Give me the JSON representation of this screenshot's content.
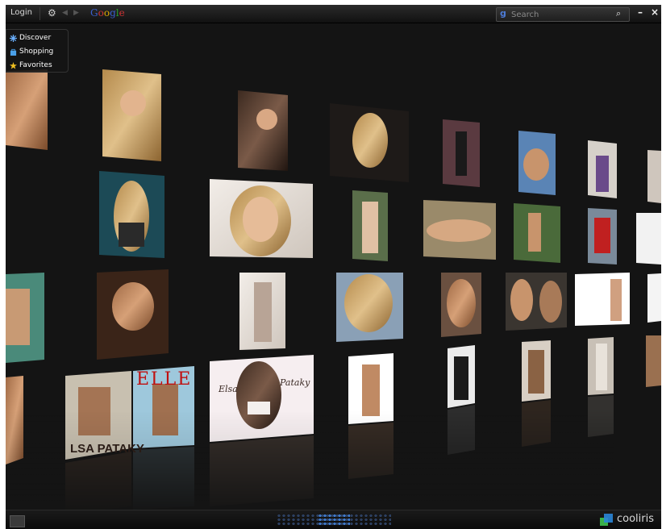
{
  "toolbar": {
    "login_label": "Login",
    "google_letters": [
      "G",
      "o",
      "o",
      "g",
      "l",
      "e"
    ],
    "search_placeholder": "Search",
    "minimize": "–",
    "close": "×"
  },
  "menu": {
    "items": [
      {
        "label": "Discover",
        "icon": "snowflake-icon"
      },
      {
        "label": "Shopping",
        "icon": "shopping-bag-icon"
      },
      {
        "label": "Favorites",
        "icon": "star-icon"
      }
    ]
  },
  "wall": {
    "captions": {
      "magazine_bottom": "LSA PATAKY",
      "elle": "ELLE",
      "elsa": "Elsa",
      "pataky": "Pataky"
    }
  },
  "footer": {
    "brand": "cooliris"
  }
}
